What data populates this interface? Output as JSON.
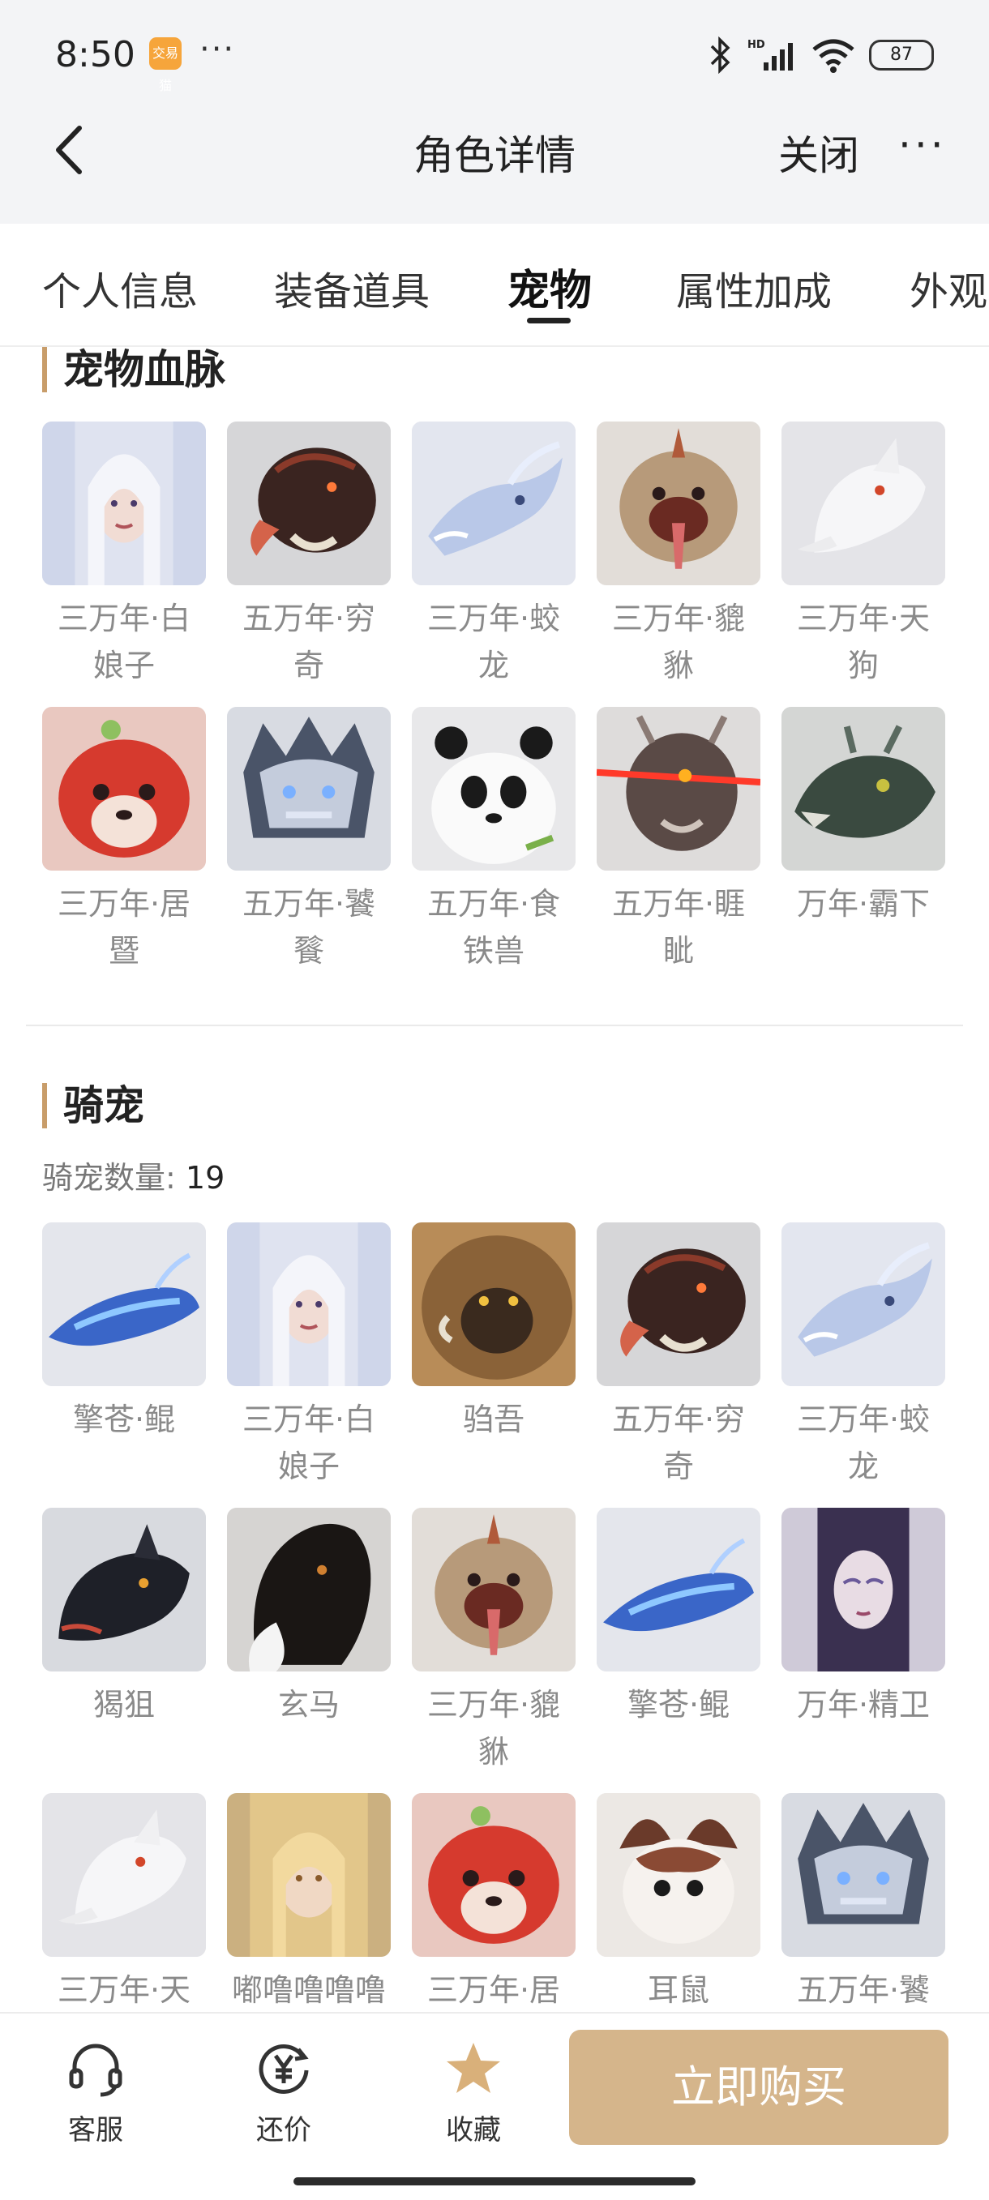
{
  "status_bar": {
    "time": "8:50",
    "app_icon_text": "交易猫",
    "dots": "···",
    "battery": "87",
    "icons": [
      "bluetooth-icon",
      "hd-signal-icon",
      "wifi-icon",
      "battery-icon"
    ]
  },
  "header": {
    "back_icon": "chevron-left-icon",
    "title": "角色详情",
    "close_label": "关闭",
    "more_label": "···"
  },
  "tabs": [
    {
      "label": "个人信息",
      "active": false
    },
    {
      "label": "装备道具",
      "active": false
    },
    {
      "label": "宠物",
      "active": true
    },
    {
      "label": "属性加成",
      "active": false
    },
    {
      "label": "外观",
      "active": false
    }
  ],
  "pet_bloodline": {
    "title": "宠物血脉",
    "items": [
      {
        "name": "三万年·白娘子",
        "icon": "white-lady-portrait"
      },
      {
        "name": "五万年·穷奇",
        "icon": "qiongqi-beast"
      },
      {
        "name": "三万年·蛟龙",
        "icon": "jiaolong-dragon"
      },
      {
        "name": "三万年·貔貅",
        "icon": "pixiu-beast"
      },
      {
        "name": "三万年·天狗",
        "icon": "tiangou-wolf"
      },
      {
        "name": "三万年·居暨",
        "icon": "juji-red-fox"
      },
      {
        "name": "五万年·饕餮",
        "icon": "taotie-beast"
      },
      {
        "name": "五万年·食铁兽",
        "icon": "panda"
      },
      {
        "name": "五万年·睚眦",
        "icon": "yazi-dragon"
      },
      {
        "name": "万年·霸下",
        "icon": "baxia-dragon"
      }
    ]
  },
  "mounts": {
    "title": "骑宠",
    "count_label": "骑宠数量:",
    "count": "19",
    "items": [
      {
        "name": "擎苍·鲲",
        "icon": "kun-blue-fish"
      },
      {
        "name": "三万年·白娘子",
        "icon": "white-lady-portrait"
      },
      {
        "name": "驺吾",
        "icon": "zouwu-lion"
      },
      {
        "name": "五万年·穷奇",
        "icon": "qiongqi-beast"
      },
      {
        "name": "三万年·蛟龙",
        "icon": "jiaolong-dragon"
      },
      {
        "name": "猲狙",
        "icon": "black-wolf"
      },
      {
        "name": "玄马",
        "icon": "black-horse"
      },
      {
        "name": "三万年·貔貅",
        "icon": "pixiu-beast"
      },
      {
        "name": "擎苍·鲲",
        "icon": "kun-blue-fish"
      },
      {
        "name": "万年·精卫",
        "icon": "jingwei-portrait"
      },
      {
        "name": "三万年·天",
        "icon": "tiangou-wolf"
      },
      {
        "name": "嘟噜噜噜噜",
        "icon": "blonde-girl-portrait"
      },
      {
        "name": "三万年·居",
        "icon": "juji-red-fox"
      },
      {
        "name": "耳鼠",
        "icon": "ear-mouse"
      },
      {
        "name": "五万年·饕",
        "icon": "taotie-beast"
      }
    ]
  },
  "bottom_bar": {
    "service_label": "客服",
    "bargain_label": "还价",
    "favorite_label": "收藏",
    "buy_label": "立即购买",
    "colors": {
      "accent": "#d5b58b",
      "favorite": "#d9b07a",
      "section_bar": "#c89d6a"
    }
  }
}
